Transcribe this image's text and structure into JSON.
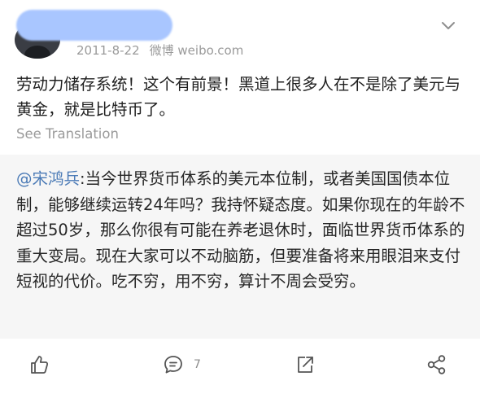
{
  "post": {
    "date": "2011-8-22",
    "source": "微博 weibo.com",
    "text": "劳动力储存系统！这个有前景！黑道上很多人在不是除了美元与黄金，就是比特币了。",
    "see_translation": "See Translation"
  },
  "repost": {
    "mention": "@宋鸿兵",
    "text": ":当今世界货币体系的美元本位制，或者美国国债本位制，能够继续运转24年吗？我持怀疑态度。如果你现在的年龄不超过50岁，那么你很有可能在养老退休时，面临世界货币体系的重大变局。现在大家可以不动脑筋，但要准备将来用眼泪来支付短视的代价。吃不穷，用不穷，算计不周会受穷。"
  },
  "actions": {
    "comment_count": "7"
  },
  "icons": [
    "chevron-down-icon",
    "like-icon",
    "comment-icon",
    "repost-icon",
    "share-icon"
  ],
  "colors": {
    "mention": "#4a7ab6",
    "meta": "#9a9a9a",
    "repost_bg": "#f6f6f6"
  }
}
